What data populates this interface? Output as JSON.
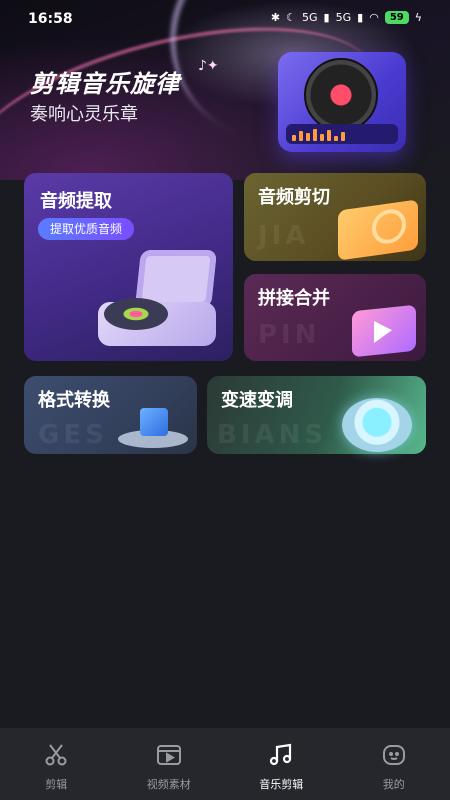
{
  "status_bar": {
    "time": "16:58",
    "network_1": "5G",
    "network_2": "5G",
    "battery": "59"
  },
  "header": {
    "title": "剪辑音乐旋律",
    "subtitle": "奏响心灵乐章"
  },
  "cards": {
    "extract": {
      "title": "音频提取",
      "button": "提取优质音频"
    },
    "cut": {
      "title": "音频剪切",
      "watermark": "JIA"
    },
    "merge": {
      "title": "拼接合并",
      "watermark": "PIN"
    },
    "format": {
      "title": "格式转换",
      "watermark": "GES"
    },
    "speed": {
      "title": "变速变调",
      "watermark": "BIANS"
    }
  },
  "bottom_nav": {
    "items": [
      {
        "label": "剪辑",
        "icon": "scissors-icon",
        "active": false
      },
      {
        "label": "视频素材",
        "icon": "video-icon",
        "active": false
      },
      {
        "label": "音乐剪辑",
        "icon": "music-note-icon",
        "active": true
      },
      {
        "label": "我的",
        "icon": "profile-icon",
        "active": false
      }
    ]
  },
  "colors": {
    "background": "#1a1b20",
    "nav_background": "#26272d",
    "accent_purple": "#5a3aa8",
    "accent_gold": "#6b6432",
    "accent_magenta": "#5a2a55",
    "accent_slate": "#3d4d6e",
    "accent_green": "#58b88c"
  }
}
